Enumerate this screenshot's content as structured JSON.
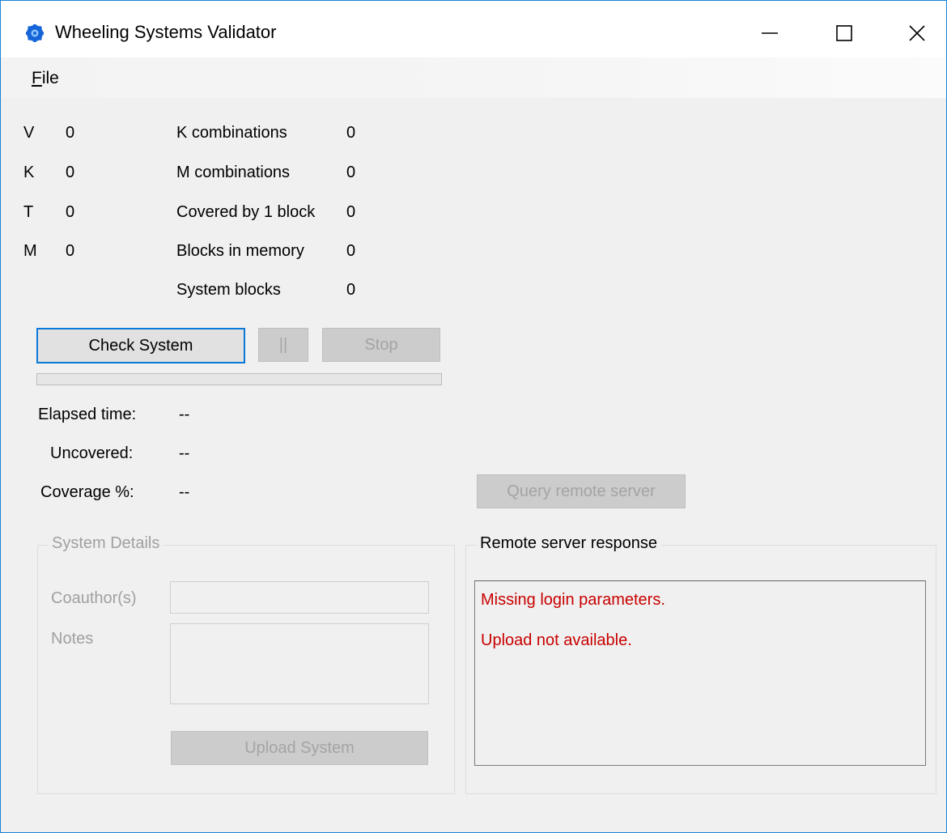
{
  "window": {
    "title": "Wheeling Systems Validator",
    "controls": {
      "minimize": "minimize",
      "maximize": "maximize",
      "close": "close"
    }
  },
  "menu": {
    "file_mnemonic": "F",
    "file_rest": "ile"
  },
  "params": [
    {
      "label": "V",
      "value": "0"
    },
    {
      "label": "K",
      "value": "0"
    },
    {
      "label": "T",
      "value": "0"
    },
    {
      "label": "M",
      "value": "0"
    }
  ],
  "stats": [
    {
      "label": "K combinations",
      "value": "0"
    },
    {
      "label": "M combinations",
      "value": "0"
    },
    {
      "label": "Covered by 1 block",
      "value": "0"
    },
    {
      "label": "Blocks in memory",
      "value": "0"
    },
    {
      "label": "System blocks",
      "value": "0"
    }
  ],
  "buttons": {
    "check": "Check System",
    "pause": "||",
    "stop": "Stop",
    "query": "Query remote server",
    "upload": "Upload System"
  },
  "progress": {
    "value": 0
  },
  "results": [
    {
      "label": "Elapsed time:",
      "value": "--"
    },
    {
      "label": "Uncovered:",
      "value": "--"
    },
    {
      "label": "Coverage %:",
      "value": "--"
    }
  ],
  "details": {
    "title": "System Details",
    "coauthor_label": "Coauthor(s)",
    "coauthor_value": "",
    "notes_label": "Notes",
    "notes_value": ""
  },
  "remote": {
    "title": "Remote server response",
    "lines": [
      "Missing login parameters.",
      "Upload not available."
    ]
  },
  "colors": {
    "accent": "#0a78d7",
    "error_text": "#c80000",
    "disabled_text": "#a0a0a0"
  }
}
